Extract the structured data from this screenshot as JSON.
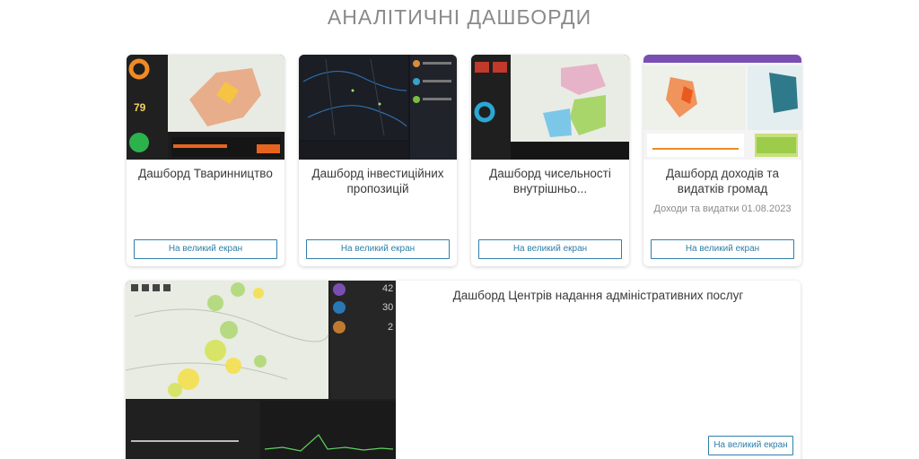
{
  "page": {
    "title": "АНАЛІТИЧНІ ДАШБОРДИ"
  },
  "cards": [
    {
      "title": "Дашборд Тваринництво",
      "subtitle": "",
      "button": "На великий екран",
      "thumb_number": "79"
    },
    {
      "title": "Дашборд інвестиційних пропозицій",
      "subtitle": "",
      "button": "На великий екран"
    },
    {
      "title": "Дашборд чисельності внутрішньо...",
      "subtitle": "",
      "button": "На великий екран"
    },
    {
      "title": "Дашборд доходів та видатків громад",
      "subtitle": "Доходи та видатки 01.08.2023",
      "button": "На великий екран"
    }
  ],
  "wide_card": {
    "title": "Дашборд Центрів надання адміністративних послуг",
    "button": "На великий екран",
    "stats": [
      "42",
      "30",
      "2"
    ]
  },
  "colors": {
    "accent": "#2f7fa8",
    "title_gray": "#8a8a8a",
    "map_dark": "#1b1d22"
  }
}
